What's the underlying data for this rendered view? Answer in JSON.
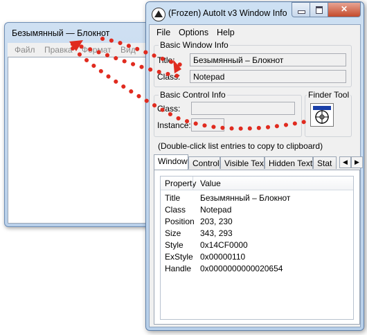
{
  "notepad": {
    "title": "Безымянный — Блокнот",
    "menu": [
      "Файл",
      "Правка",
      "Формат",
      "Вид"
    ]
  },
  "autoit": {
    "title": "(Frozen) AutoIt v3 Window Info",
    "menu": [
      "File",
      "Options",
      "Help"
    ],
    "basic_window": {
      "legend": "Basic Window Info",
      "title_label": "Title:",
      "title_value": "Безымянный – Блокнот",
      "class_label": "Class:",
      "class_value": "Notepad"
    },
    "basic_control": {
      "legend": "Basic Control Info",
      "class_label": "Class:",
      "instance_label": "Instance:"
    },
    "finder_tool": {
      "legend": "Finder Tool"
    },
    "hint": "(Double-click list entries to copy to clipboard)",
    "tabs": [
      "Window",
      "Control",
      "Visible Text",
      "Hidden Text",
      "Stat"
    ],
    "active_tab": "Window",
    "list": {
      "columns": [
        "Property",
        "Value"
      ],
      "rows": [
        {
          "property": "Title",
          "value": "Безымянный – Блокнот"
        },
        {
          "property": "Class",
          "value": "Notepad"
        },
        {
          "property": "Position",
          "value": "203, 230"
        },
        {
          "property": "Size",
          "value": "343, 293"
        },
        {
          "property": "Style",
          "value": "0x14CF0000"
        },
        {
          "property": "ExStyle",
          "value": "0x00000110"
        },
        {
          "property": "Handle",
          "value": "0x0000000000020654"
        }
      ]
    }
  },
  "annotation_color": "#e02b1f"
}
